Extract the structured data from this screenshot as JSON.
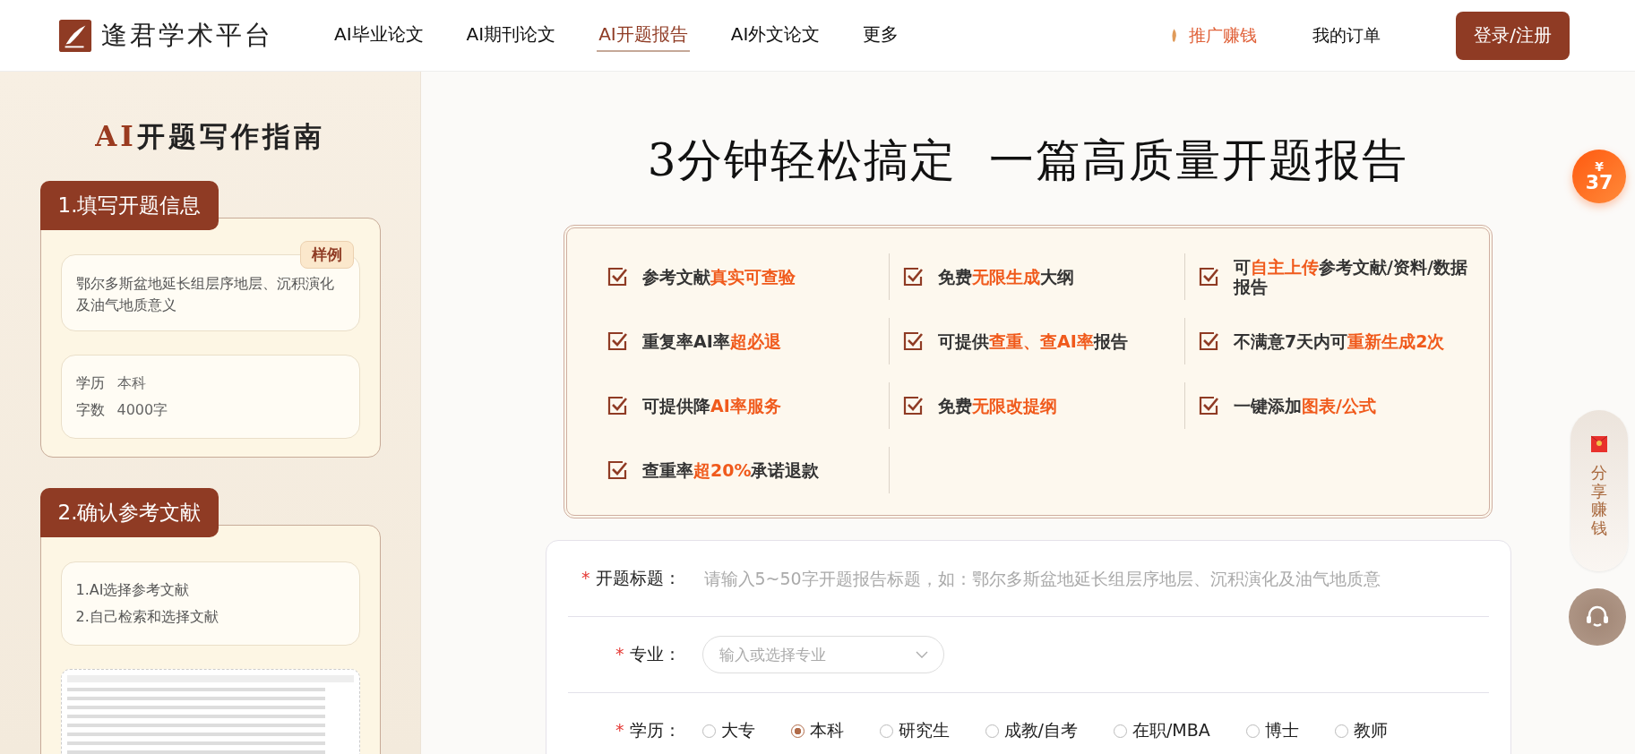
{
  "header": {
    "logo": "逢君学术平台",
    "nav": [
      {
        "label": "AI毕业论文",
        "selected": false
      },
      {
        "label": "AI期刊论文",
        "selected": false
      },
      {
        "label": "AI开题报告",
        "selected": true
      },
      {
        "label": "AI外文论文",
        "selected": false
      },
      {
        "label": "更多",
        "selected": false
      }
    ],
    "promote": "推广赚钱",
    "orders": "我的订单",
    "login": "登录/注册"
  },
  "guide": {
    "title_accent": "AI",
    "title": "开题写作指南",
    "steps": [
      {
        "kind": "info",
        "heading": "1.填写开题信息",
        "badge": "样例",
        "sample_title": "鄂尔多斯盆地延长组层序地层、沉积演化及油气地质意义",
        "fields": [
          {
            "label": "学历",
            "value": "本科"
          },
          {
            "label": "字数",
            "value": "4000字"
          }
        ]
      },
      {
        "kind": "references",
        "heading": "2.确认参考文献",
        "lines": [
          "1.AI选择参考文献",
          "2.自己检索和选择文献"
        ]
      }
    ]
  },
  "main": {
    "headline": "3分钟轻松搞定 一篇高质量开题报告",
    "features": [
      {
        "parts": [
          {
            "text": "参考文献",
            "highlight": false
          },
          {
            "text": "真实可查验",
            "highlight": true
          }
        ]
      },
      {
        "parts": [
          {
            "text": "免费",
            "highlight": false
          },
          {
            "text": "无限生成",
            "highlight": true
          },
          {
            "text": "大纲",
            "highlight": false
          }
        ]
      },
      {
        "parts": [
          {
            "text": "可",
            "highlight": false
          },
          {
            "text": "自主上传",
            "highlight": true
          },
          {
            "text": "参考文献/资料/数据报告",
            "highlight": false
          }
        ]
      },
      {
        "parts": [
          {
            "text": "重复率AI率",
            "highlight": false
          },
          {
            "text": "超必退",
            "highlight": true
          }
        ]
      },
      {
        "parts": [
          {
            "text": "可提供",
            "highlight": false
          },
          {
            "text": "查重、查AI率",
            "highlight": true
          },
          {
            "text": "报告",
            "highlight": false
          }
        ]
      },
      {
        "parts": [
          {
            "text": "不满意7天内可",
            "highlight": false
          },
          {
            "text": "重新生成2次",
            "highlight": true
          }
        ]
      },
      {
        "parts": [
          {
            "text": "可提供降",
            "highlight": false
          },
          {
            "text": "AI率服务",
            "highlight": true
          }
        ]
      },
      {
        "parts": [
          {
            "text": "免费",
            "highlight": false
          },
          {
            "text": "无限改提纲",
            "highlight": true
          }
        ]
      },
      {
        "parts": [
          {
            "text": "一键添加",
            "highlight": false
          },
          {
            "text": "图表/公式",
            "highlight": true
          }
        ]
      },
      {
        "parts": [
          {
            "text": "查重率",
            "highlight": false
          },
          {
            "text": "超20%",
            "highlight": true
          },
          {
            "text": "承诺退款",
            "highlight": false
          }
        ]
      }
    ],
    "form": {
      "required_mark": "*",
      "title_label": "开题标题：",
      "title_placeholder": "请输入5~50字开题报告标题，如：鄂尔多斯盆地延长组层序地层、沉积演化及油气地质意",
      "major_label": "专业：",
      "major_placeholder": "输入或选择专业",
      "degree_label": "学历：",
      "degrees": [
        {
          "label": "大专",
          "selected": false
        },
        {
          "label": "本科",
          "selected": true
        },
        {
          "label": "研究生",
          "selected": false
        },
        {
          "label": "成教/自考",
          "selected": false
        },
        {
          "label": "在职/MBA",
          "selected": false
        },
        {
          "label": "博士",
          "selected": false
        },
        {
          "label": "教师",
          "selected": false
        }
      ]
    }
  },
  "float": {
    "coupon_symbol": "¥",
    "coupon_amount": "37",
    "share": "分享赚钱"
  }
}
